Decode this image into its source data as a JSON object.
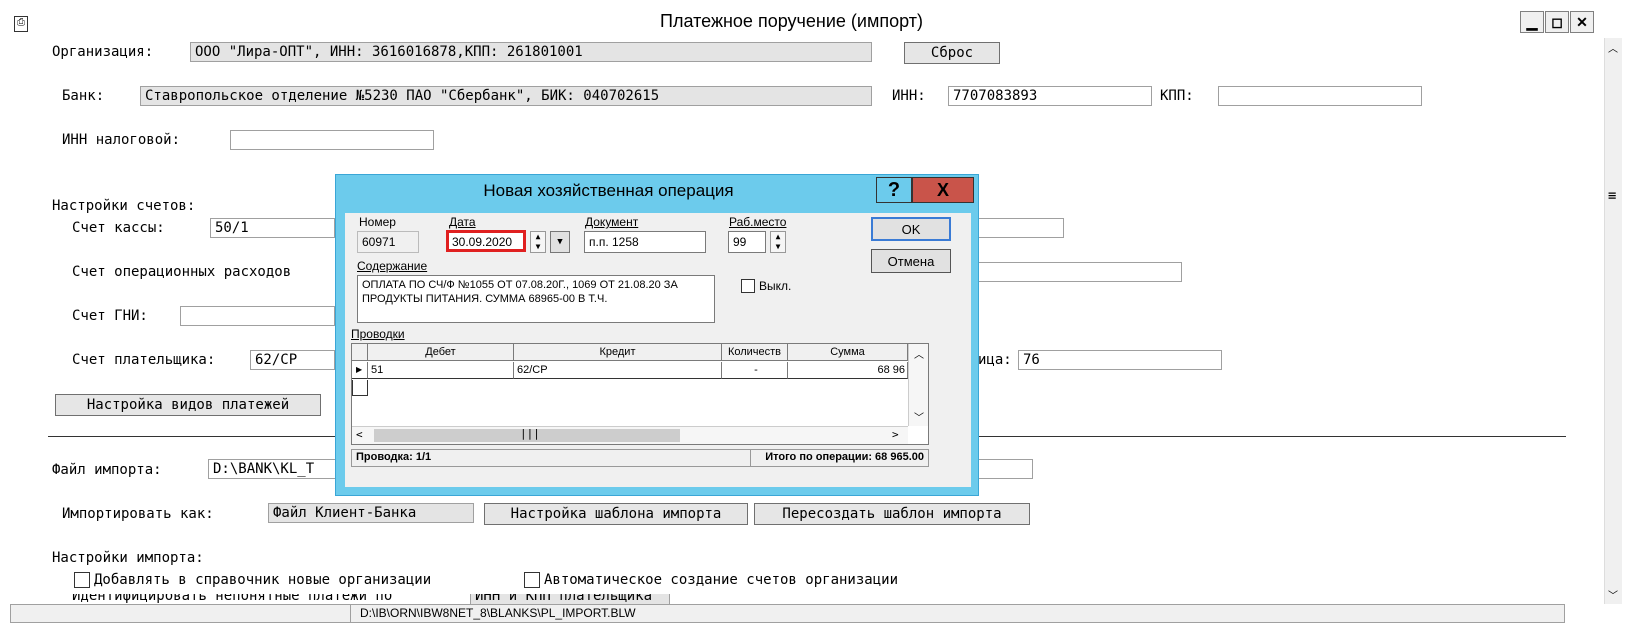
{
  "window": {
    "title": "Платежное поручение (импорт)",
    "minimize": "▁",
    "maximize": "◻",
    "close": "✕"
  },
  "form": {
    "org_label": "Организация:",
    "org_value": "ООО \"Лира-ОПТ\", ИНН: 3616016878,КПП: 261801001",
    "reset_button": "Сброс",
    "bank_label": "Банк:",
    "bank_value": "Ставропольское отделение №5230 ПАО \"Сбербанк\", БИК: 040702615",
    "inn_label": "ИНН:",
    "inn_value": "7707083893",
    "kpp_label": "КПП:",
    "kpp_value": "",
    "tax_inn_label": "ИНН налоговой:",
    "tax_inn_value": "",
    "accounts_header": "Настройки счетов:",
    "cash_account_label": "Счет кассы:",
    "cash_account_value": "50/1",
    "op_expense_label": "Счет операционных расходов",
    "gni_label": "Счет ГНИ:",
    "payer_account_label": "Счет плательщика:",
    "payer_account_value": "62/СР",
    "recipient_suffix": "ица:",
    "recipient_value": "76",
    "payment_types_button": "Настройка видов платежей",
    "import_file_label": "Файл импорта:",
    "import_file_value": "D:\\BANK\\KL_T",
    "import_as_label": "Импортировать как:",
    "import_as_value": "Файл Клиент-Банка",
    "template_setup_button": "Настройка шаблона импорта",
    "template_recreate_button": "Пересоздать шаблон импорта",
    "import_settings_header": "Настройки импорта:",
    "chk_add_orgs": "Добавлять в справочник новые организации",
    "chk_auto_accounts": "Автоматическое создание счетов организации",
    "cut_off_text": "Идентифицировать непонятные платежи по",
    "cut_off_field": "ИНН и КПП плательщика"
  },
  "status": {
    "path": "D:\\IB\\ORN\\IBW8NET_8\\BLANKS\\PL_IMPORT.BLW"
  },
  "dialog": {
    "title": "Новая хозяйственная операция",
    "help": "?",
    "close": "X",
    "number_label": "Номер",
    "number_value": "60971",
    "date_label": "Дата",
    "date_value": "30.09.2020",
    "doc_label": "Документ",
    "doc_value": "п.п. 1258",
    "workplace_label": "Раб.место",
    "workplace_value": "99",
    "ok_button": "OK",
    "cancel_button": "Отмена",
    "content_label": "Содержание",
    "content_value": "ОПЛАТА ПО СЧ/Ф №1055 ОТ 07.08.20Г., 1069 ОТ 21.08.20 ЗА ПРОДУКТЫ ПИТАНИЯ. СУММА 68965-00 В Т.Ч.",
    "off_label": "Выкл.",
    "entries_label": "Проводки",
    "columns": [
      "Дебет",
      "Кредит",
      "Количеств",
      "Сумма"
    ],
    "row": {
      "debit": "51",
      "credit": "62/СР",
      "qty": "-",
      "sum": "68 96"
    },
    "footer_left": "Проводка: 1/1",
    "footer_right": "Итого по операции: 68 965.00"
  }
}
